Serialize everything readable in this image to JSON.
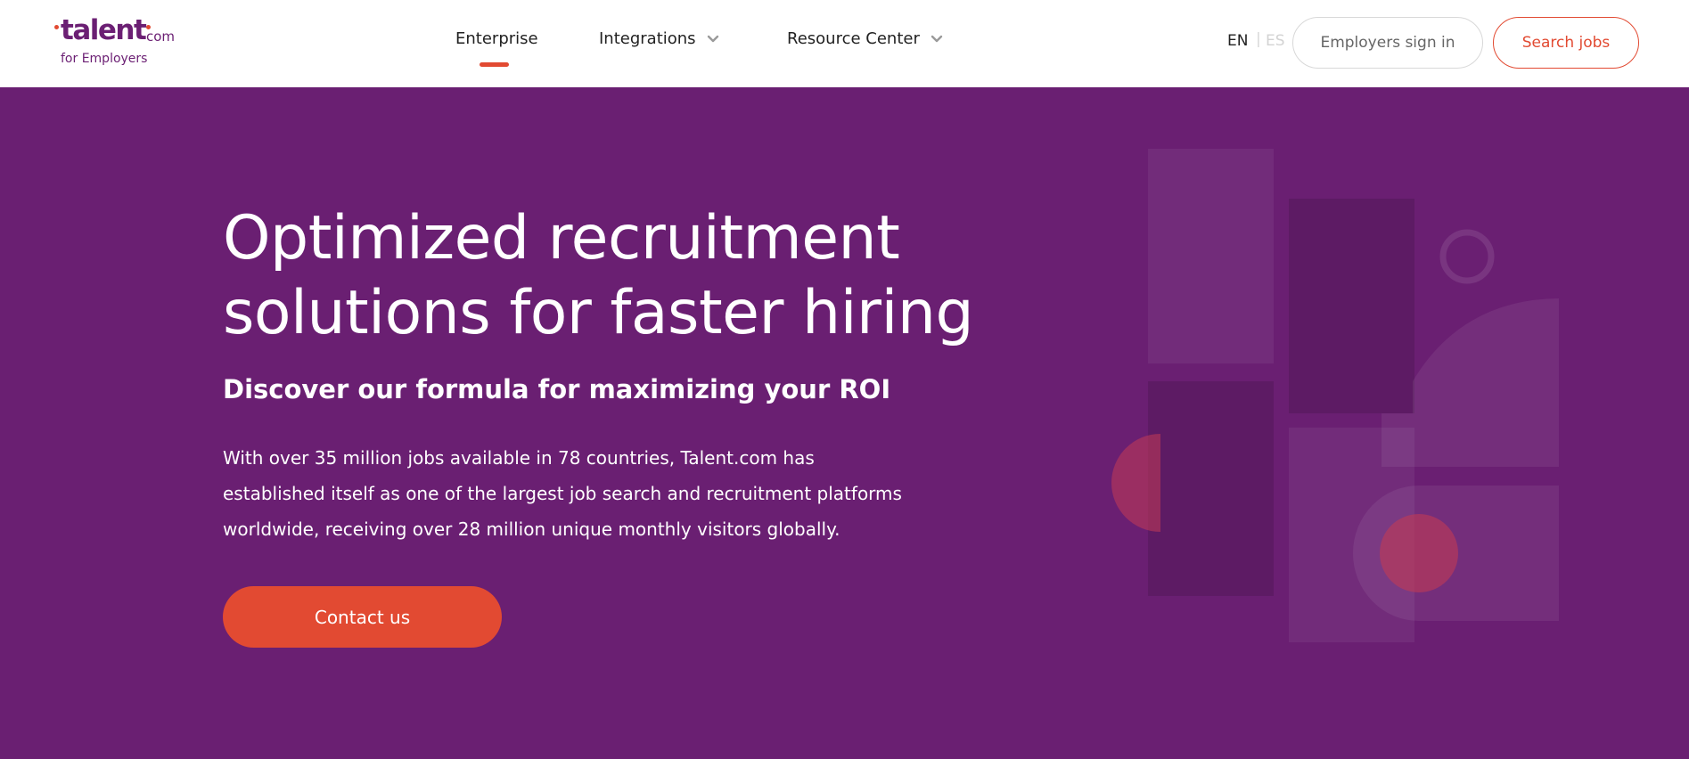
{
  "brand": {
    "logo_word": "talent",
    "logo_suffix": "com",
    "logo_subtitle": "for Employers",
    "primary_color": "#6a1f72",
    "accent_color": "#e24a32"
  },
  "nav": {
    "items": [
      {
        "label": "Enterprise",
        "active": true,
        "has_dropdown": false
      },
      {
        "label": "Integrations",
        "active": false,
        "has_dropdown": true
      },
      {
        "label": "Resource Center",
        "active": false,
        "has_dropdown": true
      }
    ],
    "chevron_icon": "chevron-down-icon"
  },
  "language": {
    "options": [
      "EN",
      "ES"
    ],
    "separator": "|",
    "selected": "EN"
  },
  "actions": {
    "signin_label": "Employers sign in",
    "search_label": "Search jobs"
  },
  "hero": {
    "title_lines": [
      "Optimized recruitment",
      "solutions for faster hiring"
    ],
    "subtitle": "Discover our formula for maximizing your ROI",
    "body_lines": [
      "With over 35 million jobs available in 78 countries, Talent.com has",
      "established itself as one of the largest job search and recruitment platforms",
      "worldwide, receiving over 28 million unique monthly visitors globally."
    ],
    "cta_label": "Contact us"
  }
}
